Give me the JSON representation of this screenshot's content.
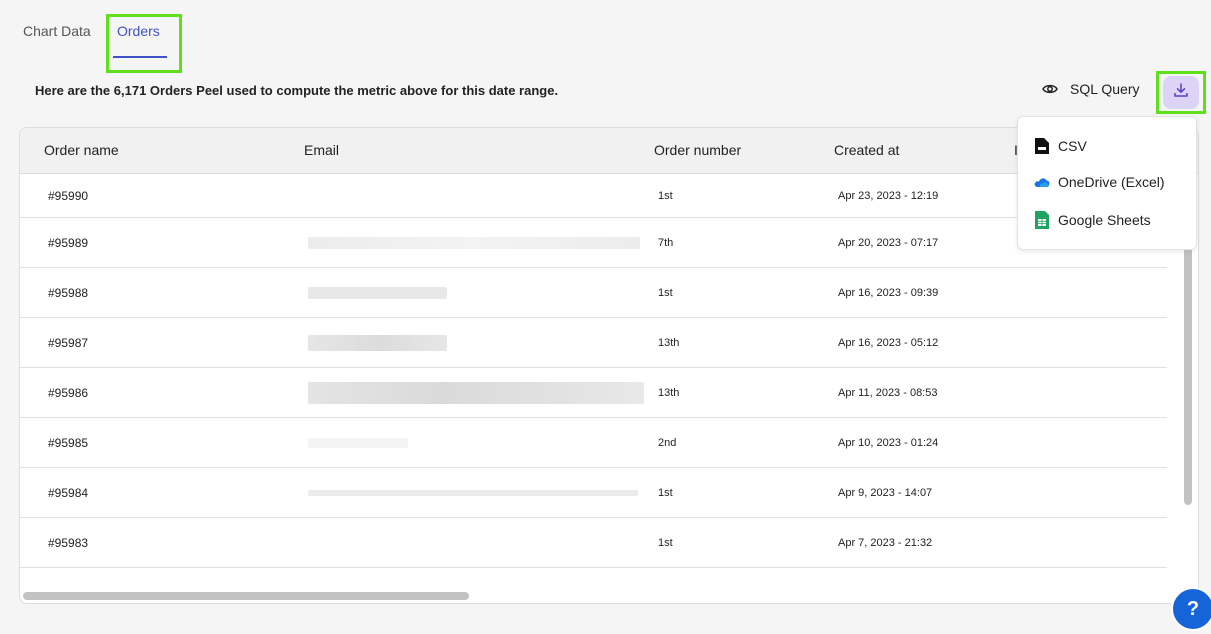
{
  "tabs": [
    {
      "label": "Chart Data"
    },
    {
      "label": "Orders"
    }
  ],
  "info_text": "Here are the 6,171 Orders Peel used to compute the metric above for this date range.",
  "sql_query_label": "SQL Query",
  "icons": {
    "eye": "eye-icon",
    "download": "download-icon",
    "csv": "csv-file-icon",
    "onedrive": "onedrive-cloud-icon",
    "sheets": "google-sheets-icon",
    "help": "help-icon"
  },
  "colors": {
    "accent": "#3f51c6",
    "highlight_box": "#5fe01a",
    "download_bg": "#dcd4f7",
    "help_bg": "#1565d8"
  },
  "table": {
    "columns": [
      "Order name",
      "Email",
      "Order number",
      "Created at",
      "I"
    ],
    "rows": [
      {
        "name": "#95990",
        "number": "1st",
        "created": "Apr 23, 2023 - 12:19"
      },
      {
        "name": "#95989",
        "number": "7th",
        "created": "Apr 20, 2023 - 07:17"
      },
      {
        "name": "#95988",
        "number": "1st",
        "created": "Apr 16, 2023 - 09:39"
      },
      {
        "name": "#95987",
        "number": "13th",
        "created": "Apr 16, 2023 - 05:12"
      },
      {
        "name": "#95986",
        "number": "13th",
        "created": "Apr 11, 2023 - 08:53"
      },
      {
        "name": "#95985",
        "number": "2nd",
        "created": "Apr 10, 2023 - 01:24"
      },
      {
        "name": "#95984",
        "number": "1st",
        "created": "Apr 9, 2023 - 14:07"
      },
      {
        "name": "#95983",
        "number": "1st",
        "created": "Apr 7, 2023 - 21:32"
      }
    ]
  },
  "export_menu": {
    "items": [
      {
        "label": "CSV"
      },
      {
        "label": "OneDrive (Excel)"
      },
      {
        "label": "Google Sheets"
      }
    ]
  },
  "help_label": "?"
}
